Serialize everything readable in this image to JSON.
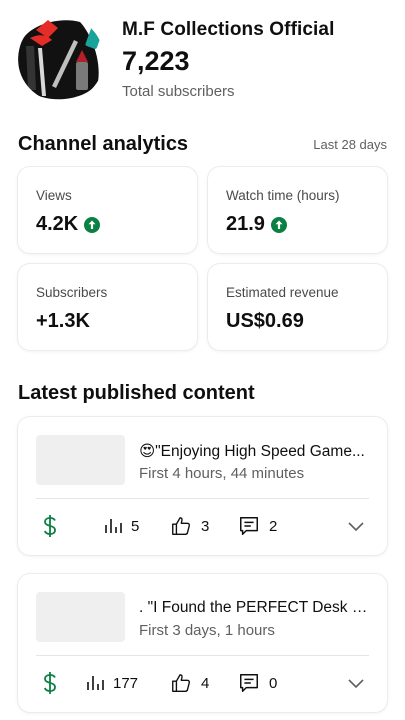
{
  "channel": {
    "name": "M.F Collections Official",
    "subscriber_count": "7,223",
    "subscriber_caption": "Total subscribers"
  },
  "analytics": {
    "title": "Channel analytics",
    "period": "Last 28 days",
    "stats": [
      {
        "label": "Views",
        "value": "4.2K",
        "trend": "up"
      },
      {
        "label": "Watch time (hours)",
        "value": "21.9",
        "trend": "up"
      },
      {
        "label": "Subscribers",
        "value": "+1.3K"
      },
      {
        "label": "Estimated revenue",
        "value": "US$0.69"
      }
    ]
  },
  "latest": {
    "title": "Latest published content",
    "items": [
      {
        "title": "😍\"Enjoying High Speed Game...",
        "meta": "First 4 hours, 44 minutes",
        "views": "5",
        "likes": "3",
        "comments": "2"
      },
      {
        "title": ". \"I Found the PERFECT Desk P...",
        "meta": "First 3 days, 1 hours",
        "views": "177",
        "likes": "4",
        "comments": "0"
      }
    ]
  },
  "colors": {
    "trend_up": "#0b8043",
    "revenue_icon": "#0b8043",
    "secondary_text": "#606060",
    "avatar_accent": "#e52d27",
    "avatar_teal": "#1aa39a"
  },
  "icons": {
    "trend": "arrow-up-circle-icon",
    "revenue": "dollar-icon",
    "views": "bar-chart-icon",
    "likes": "thumbs-up-icon",
    "comments": "comment-icon",
    "expand": "chevron-down-icon"
  }
}
